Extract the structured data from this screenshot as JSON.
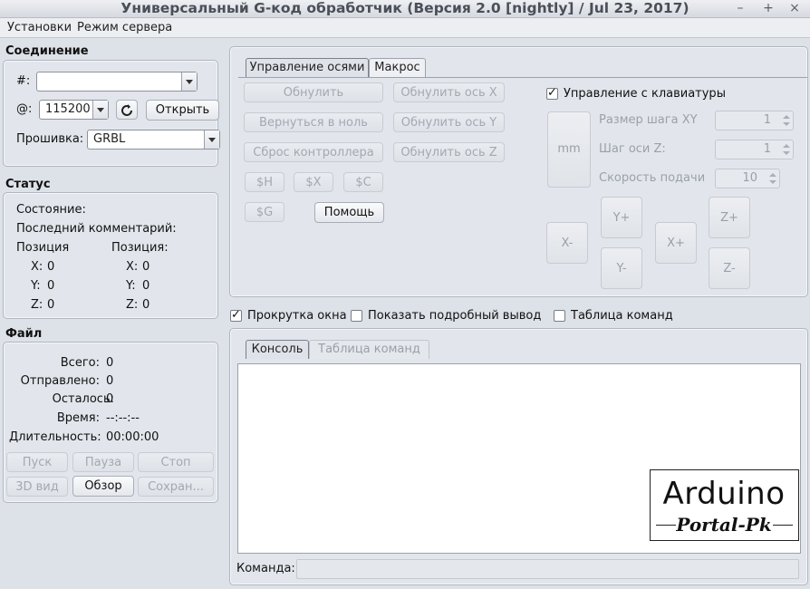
{
  "window": {
    "title": "Универсальный G-код обработчик (Версия 2.0 [nightly]  / Jul 23, 2017)",
    "controls": [
      "–",
      "+",
      "×"
    ]
  },
  "menu": [
    "Установки",
    "Режим сервера"
  ],
  "connection": {
    "title": "Соединение",
    "port_label": "#:",
    "port_value": "",
    "baud_label": "@:",
    "baud_value": "115200",
    "open_button": "Открыть",
    "firmware_label": "Прошивка:",
    "firmware_value": "GRBL",
    "refresh_icon": "refresh-icon"
  },
  "status": {
    "title": "Статус",
    "state_label": "Состояние:",
    "comment_label": "Последний комментарий:",
    "position_work_label": "Позиция",
    "position_machine_label": "Позиция:",
    "work": {
      "x_label": "X:",
      "x": "0",
      "y_label": "Y:",
      "y": "0",
      "z_label": "Z:",
      "z": "0"
    },
    "machine": {
      "x_label": "X:",
      "x": "0",
      "y_label": "Y:",
      "y": "0",
      "z_label": "Z:",
      "z": "0"
    }
  },
  "file": {
    "title": "Файл",
    "total_label": "Всего:",
    "total": "0",
    "sent_label": "Отправлено:",
    "sent": "0",
    "remaining_label": "Осталось:",
    "remaining": "0",
    "time_label": "Время:",
    "time": "--:--:--",
    "duration_label": "Длительность:",
    "duration": "00:00:00",
    "buttons": {
      "start": "Пуск",
      "pause": "Пауза",
      "stop": "Стоп",
      "view3d": "3D вид",
      "browse": "Обзор",
      "save": "Сохран..."
    }
  },
  "axis_tabs": [
    "Управление осями",
    "Макрос"
  ],
  "axis": {
    "reset": "Обнулить",
    "return_zero": "Вернуться в ноль",
    "soft_reset": "Сброс контроллера",
    "reset_x": "Обнулить ось X",
    "reset_y": "Обнулить ось Y",
    "reset_z": "Обнулить ось Z",
    "cmd_h": "$H",
    "cmd_x": "$X",
    "cmd_c": "$C",
    "cmd_g": "$G",
    "help": "Помощь",
    "keyboard_label": "Управление с клавиатуры",
    "unit_button": "mm",
    "step_xy_label": "Размер шага XY",
    "step_xy": "1",
    "step_z_label": "Шаг оси Z:",
    "step_z": "1",
    "feed_label": "Скорость подачи",
    "feed": "10",
    "jog": {
      "xm": "X-",
      "xp": "X+",
      "yp": "Y+",
      "ym": "Y-",
      "zp": "Z+",
      "zm": "Z-"
    }
  },
  "options": {
    "scroll": "Прокрутка окна",
    "verbose": "Показать подробный вывод",
    "cmd_table": "Таблица команд"
  },
  "console_tabs": [
    "Консоль",
    "Таблица команд"
  ],
  "command_label": "Команда:",
  "command_value": "",
  "watermark": {
    "line1": "Arduino",
    "line2": "Portal-Pk"
  }
}
